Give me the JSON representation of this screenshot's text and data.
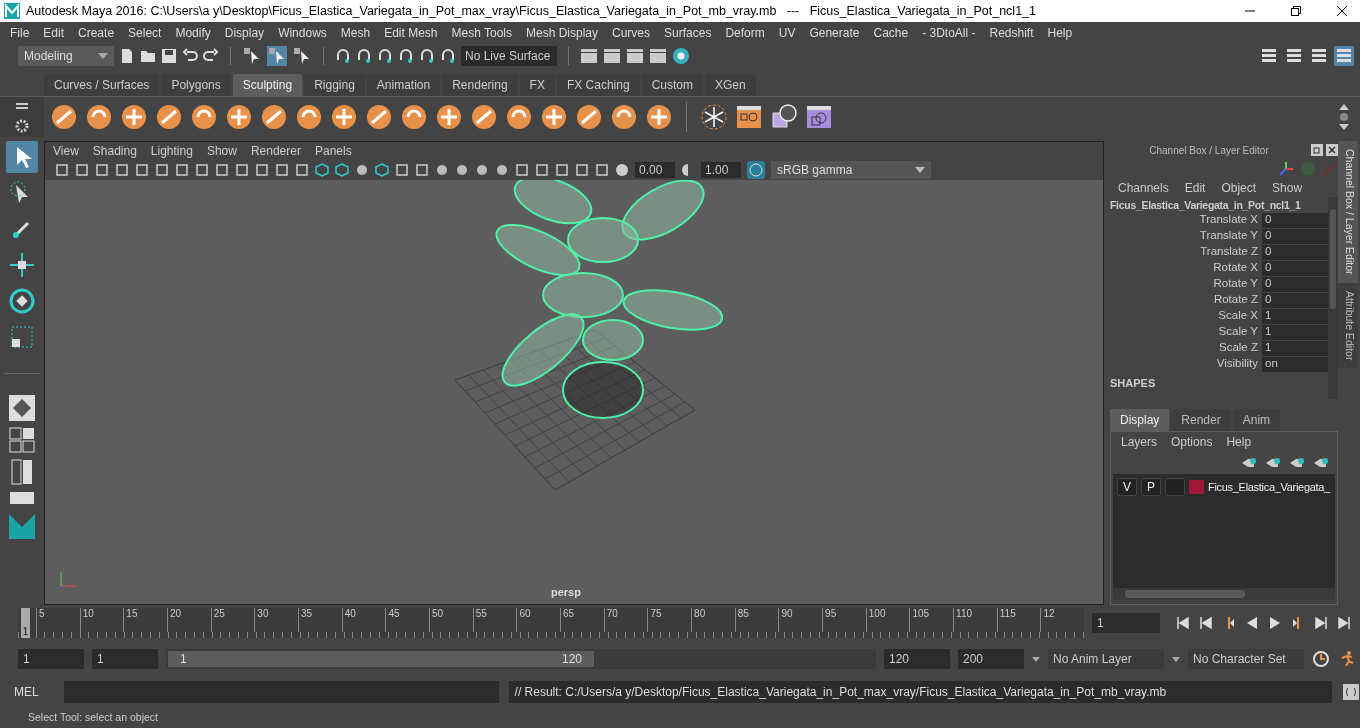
{
  "window": {
    "title": "Autodesk Maya 2016: C:\\Users\\a y\\Desktop\\Ficus_Elastica_Variegata_in_Pot_max_vray\\Ficus_Elastica_Variegata_in_Pot_mb_vray.mb   ---   Ficus_Elastica_Variegata_in_Pot_ncl1_1"
  },
  "menu": [
    "File",
    "Edit",
    "Create",
    "Select",
    "Modify",
    "Display",
    "Windows",
    "Mesh",
    "Edit Mesh",
    "Mesh Tools",
    "Mesh Display",
    "Curves",
    "Surfaces",
    "Deform",
    "UV",
    "Generate",
    "Cache",
    "- 3DtoAll -",
    "Redshift",
    "Help"
  ],
  "status_line": {
    "mode": "Modeling",
    "live_surface": "No Live Surface"
  },
  "shelf_tabs": [
    {
      "label": "Curves / Surfaces",
      "selected": false
    },
    {
      "label": "Polygons",
      "selected": false
    },
    {
      "label": "Sculpting",
      "selected": true
    },
    {
      "label": "Rigging",
      "selected": false
    },
    {
      "label": "Animation",
      "selected": false
    },
    {
      "label": "Rendering",
      "selected": false
    },
    {
      "label": "FX",
      "selected": false
    },
    {
      "label": "FX Caching",
      "selected": false
    },
    {
      "label": "Custom",
      "selected": false
    },
    {
      "label": "XGen",
      "selected": false
    }
  ],
  "toolbox": [
    {
      "selected": true
    },
    {
      "selected": false
    },
    {
      "selected": false
    },
    {
      "selected": false
    },
    {
      "selected": false
    },
    {
      "selected": false
    }
  ],
  "viewport": {
    "menu": [
      "View",
      "Shading",
      "Lighting",
      "Show",
      "Renderer",
      "Panels"
    ],
    "exposure": "0.00",
    "gamma": "1.00",
    "color_space": "sRGB gamma",
    "camera": "persp"
  },
  "channel_box": {
    "title": "Channel Box / Layer Editor",
    "menu": [
      "Channels",
      "Edit",
      "Object",
      "Show"
    ],
    "object": "Ficus_Elastica_Variegata_in_Pot_ncl1_1",
    "channels": [
      {
        "name": "Translate X",
        "value": "0"
      },
      {
        "name": "Translate Y",
        "value": "0"
      },
      {
        "name": "Translate Z",
        "value": "0"
      },
      {
        "name": "Rotate X",
        "value": "0"
      },
      {
        "name": "Rotate Y",
        "value": "0"
      },
      {
        "name": "Rotate Z",
        "value": "0"
      },
      {
        "name": "Scale X",
        "value": "1"
      },
      {
        "name": "Scale Y",
        "value": "1"
      },
      {
        "name": "Scale Z",
        "value": "1"
      },
      {
        "name": "Visibility",
        "value": "on"
      }
    ],
    "shapes_heading": "SHAPES",
    "side_tabs": [
      {
        "label": "Channel Box / Layer Editor",
        "selected": true
      },
      {
        "label": "Attribute Editor",
        "selected": false
      }
    ]
  },
  "layer_editor": {
    "tabs": [
      {
        "label": "Display",
        "selected": true
      },
      {
        "label": "Render",
        "selected": false
      },
      {
        "label": "Anim",
        "selected": false
      }
    ],
    "menu": [
      "Layers",
      "Options",
      "Help"
    ],
    "layers": [
      {
        "visible": "V",
        "playback": "P",
        "color": "#a0173a",
        "name": "Ficus_Elastica_Variegata_"
      }
    ]
  },
  "timeline": {
    "current_frame": "1",
    "level": 0,
    "ticks": [
      "5",
      "10",
      "15",
      "20",
      "25",
      "30",
      "35",
      "40",
      "45",
      "50",
      "55",
      "60",
      "65",
      "70",
      "75",
      "80",
      "85",
      "90",
      "95",
      "100",
      "105",
      "110",
      "115",
      "12"
    ],
    "frame_field": "1"
  },
  "range": {
    "level": 0.6,
    "start": "1",
    "playback_start": "1",
    "slider_start": "1",
    "slider_end": "120",
    "playback_end": "120",
    "end": "200",
    "anim_layer": "No Anim Layer",
    "character_set": "No Character Set"
  },
  "command_line": {
    "language": "MEL",
    "result": "// Result: C:/Users/a y/Desktop/Ficus_Elastica_Variegata_in_Pot_max_vray/Ficus_Elastica_Variegata_in_Pot_mb_vray.mb"
  },
  "help_line": "Select Tool: select an object"
}
